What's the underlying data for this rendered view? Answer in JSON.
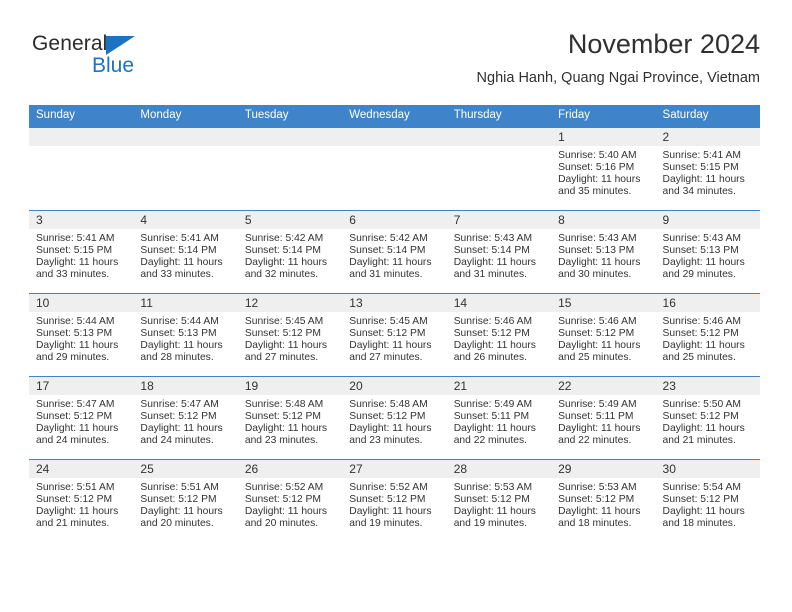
{
  "brand": {
    "line1": "General",
    "line2": "Blue",
    "triangle_color": "#1c72c4",
    "text_color": "#2b2b2b"
  },
  "header": {
    "title": "November 2024",
    "subtitle": "Nghia Hanh, Quang Ngai Province, Vietnam"
  },
  "colors": {
    "header_row": "#3f84c8",
    "date_band": "#efefef",
    "grid_line": "#3f84c8",
    "text": "#333333"
  },
  "weekday_headers": [
    "Sunday",
    "Monday",
    "Tuesday",
    "Wednesday",
    "Thursday",
    "Friday",
    "Saturday"
  ],
  "labels": {
    "sunrise": "Sunrise:",
    "sunset": "Sunset:",
    "daylight": "Daylight:"
  },
  "weeks": [
    [
      {
        "date": "",
        "empty": true
      },
      {
        "date": "",
        "empty": true
      },
      {
        "date": "",
        "empty": true
      },
      {
        "date": "",
        "empty": true
      },
      {
        "date": "",
        "empty": true
      },
      {
        "date": "1",
        "sunrise": "Sunrise: 5:40 AM",
        "sunset": "Sunset: 5:16 PM",
        "daylight": "Daylight: 11 hours and 35 minutes."
      },
      {
        "date": "2",
        "sunrise": "Sunrise: 5:41 AM",
        "sunset": "Sunset: 5:15 PM",
        "daylight": "Daylight: 11 hours and 34 minutes."
      }
    ],
    [
      {
        "date": "3",
        "sunrise": "Sunrise: 5:41 AM",
        "sunset": "Sunset: 5:15 PM",
        "daylight": "Daylight: 11 hours and 33 minutes."
      },
      {
        "date": "4",
        "sunrise": "Sunrise: 5:41 AM",
        "sunset": "Sunset: 5:14 PM",
        "daylight": "Daylight: 11 hours and 33 minutes."
      },
      {
        "date": "5",
        "sunrise": "Sunrise: 5:42 AM",
        "sunset": "Sunset: 5:14 PM",
        "daylight": "Daylight: 11 hours and 32 minutes."
      },
      {
        "date": "6",
        "sunrise": "Sunrise: 5:42 AM",
        "sunset": "Sunset: 5:14 PM",
        "daylight": "Daylight: 11 hours and 31 minutes."
      },
      {
        "date": "7",
        "sunrise": "Sunrise: 5:43 AM",
        "sunset": "Sunset: 5:14 PM",
        "daylight": "Daylight: 11 hours and 31 minutes."
      },
      {
        "date": "8",
        "sunrise": "Sunrise: 5:43 AM",
        "sunset": "Sunset: 5:13 PM",
        "daylight": "Daylight: 11 hours and 30 minutes."
      },
      {
        "date": "9",
        "sunrise": "Sunrise: 5:43 AM",
        "sunset": "Sunset: 5:13 PM",
        "daylight": "Daylight: 11 hours and 29 minutes."
      }
    ],
    [
      {
        "date": "10",
        "sunrise": "Sunrise: 5:44 AM",
        "sunset": "Sunset: 5:13 PM",
        "daylight": "Daylight: 11 hours and 29 minutes."
      },
      {
        "date": "11",
        "sunrise": "Sunrise: 5:44 AM",
        "sunset": "Sunset: 5:13 PM",
        "daylight": "Daylight: 11 hours and 28 minutes."
      },
      {
        "date": "12",
        "sunrise": "Sunrise: 5:45 AM",
        "sunset": "Sunset: 5:12 PM",
        "daylight": "Daylight: 11 hours and 27 minutes."
      },
      {
        "date": "13",
        "sunrise": "Sunrise: 5:45 AM",
        "sunset": "Sunset: 5:12 PM",
        "daylight": "Daylight: 11 hours and 27 minutes."
      },
      {
        "date": "14",
        "sunrise": "Sunrise: 5:46 AM",
        "sunset": "Sunset: 5:12 PM",
        "daylight": "Daylight: 11 hours and 26 minutes."
      },
      {
        "date": "15",
        "sunrise": "Sunrise: 5:46 AM",
        "sunset": "Sunset: 5:12 PM",
        "daylight": "Daylight: 11 hours and 25 minutes."
      },
      {
        "date": "16",
        "sunrise": "Sunrise: 5:46 AM",
        "sunset": "Sunset: 5:12 PM",
        "daylight": "Daylight: 11 hours and 25 minutes."
      }
    ],
    [
      {
        "date": "17",
        "sunrise": "Sunrise: 5:47 AM",
        "sunset": "Sunset: 5:12 PM",
        "daylight": "Daylight: 11 hours and 24 minutes."
      },
      {
        "date": "18",
        "sunrise": "Sunrise: 5:47 AM",
        "sunset": "Sunset: 5:12 PM",
        "daylight": "Daylight: 11 hours and 24 minutes."
      },
      {
        "date": "19",
        "sunrise": "Sunrise: 5:48 AM",
        "sunset": "Sunset: 5:12 PM",
        "daylight": "Daylight: 11 hours and 23 minutes."
      },
      {
        "date": "20",
        "sunrise": "Sunrise: 5:48 AM",
        "sunset": "Sunset: 5:12 PM",
        "daylight": "Daylight: 11 hours and 23 minutes."
      },
      {
        "date": "21",
        "sunrise": "Sunrise: 5:49 AM",
        "sunset": "Sunset: 5:11 PM",
        "daylight": "Daylight: 11 hours and 22 minutes."
      },
      {
        "date": "22",
        "sunrise": "Sunrise: 5:49 AM",
        "sunset": "Sunset: 5:11 PM",
        "daylight": "Daylight: 11 hours and 22 minutes."
      },
      {
        "date": "23",
        "sunrise": "Sunrise: 5:50 AM",
        "sunset": "Sunset: 5:12 PM",
        "daylight": "Daylight: 11 hours and 21 minutes."
      }
    ],
    [
      {
        "date": "24",
        "sunrise": "Sunrise: 5:51 AM",
        "sunset": "Sunset: 5:12 PM",
        "daylight": "Daylight: 11 hours and 21 minutes."
      },
      {
        "date": "25",
        "sunrise": "Sunrise: 5:51 AM",
        "sunset": "Sunset: 5:12 PM",
        "daylight": "Daylight: 11 hours and 20 minutes."
      },
      {
        "date": "26",
        "sunrise": "Sunrise: 5:52 AM",
        "sunset": "Sunset: 5:12 PM",
        "daylight": "Daylight: 11 hours and 20 minutes."
      },
      {
        "date": "27",
        "sunrise": "Sunrise: 5:52 AM",
        "sunset": "Sunset: 5:12 PM",
        "daylight": "Daylight: 11 hours and 19 minutes."
      },
      {
        "date": "28",
        "sunrise": "Sunrise: 5:53 AM",
        "sunset": "Sunset: 5:12 PM",
        "daylight": "Daylight: 11 hours and 19 minutes."
      },
      {
        "date": "29",
        "sunrise": "Sunrise: 5:53 AM",
        "sunset": "Sunset: 5:12 PM",
        "daylight": "Daylight: 11 hours and 18 minutes."
      },
      {
        "date": "30",
        "sunrise": "Sunrise: 5:54 AM",
        "sunset": "Sunset: 5:12 PM",
        "daylight": "Daylight: 11 hours and 18 minutes."
      }
    ]
  ]
}
